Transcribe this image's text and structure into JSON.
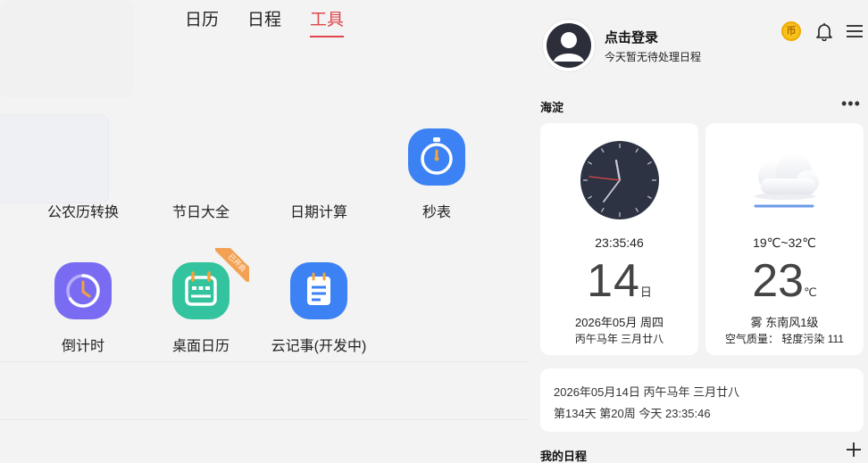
{
  "tabs": [
    {
      "label": "日历",
      "active": false
    },
    {
      "label": "日程",
      "active": false
    },
    {
      "label": "工具",
      "active": true
    }
  ],
  "tools": {
    "lunar_convert": "公农历转换",
    "holidays": "节日大全",
    "date_calc": "日期计算",
    "stopwatch": "秒表",
    "countdown": "倒计时",
    "desktop_calendar": "桌面日历",
    "desktop_calendar_badge": "已开启",
    "cloud_notes": "云记事(开发中)"
  },
  "colors": {
    "accent": "#e0474c",
    "stopwatch_bg": "#3c82f5",
    "countdown_bg": "#7a6cf2",
    "desktop_calendar_bg": "#33c39e",
    "cloud_notes_bg": "#3c82f5",
    "badge_bg": "#f3a153"
  },
  "user": {
    "name": "点击登录",
    "status": "今天暂无待处理日程"
  },
  "header_icons": {
    "coin": "币",
    "bell": "bell-icon",
    "menu": "menu-icon"
  },
  "location": "海淀",
  "clock": {
    "time": "23:35:46",
    "day": "14",
    "day_unit": "日",
    "date": "2026年05月 周四",
    "lunar": "丙午马年 三月廿八"
  },
  "weather": {
    "range": "19℃~32℃",
    "temp": "23",
    "unit": "℃",
    "desc": "雾 东南风1级",
    "aqi": "空气质量：  轻度污染 111"
  },
  "info": {
    "line1": "2026年05月14日 丙午马年 三月廿八",
    "line2": "第134天 第20周 今天 23:35:46"
  },
  "schedule": {
    "title": "我的日程"
  }
}
